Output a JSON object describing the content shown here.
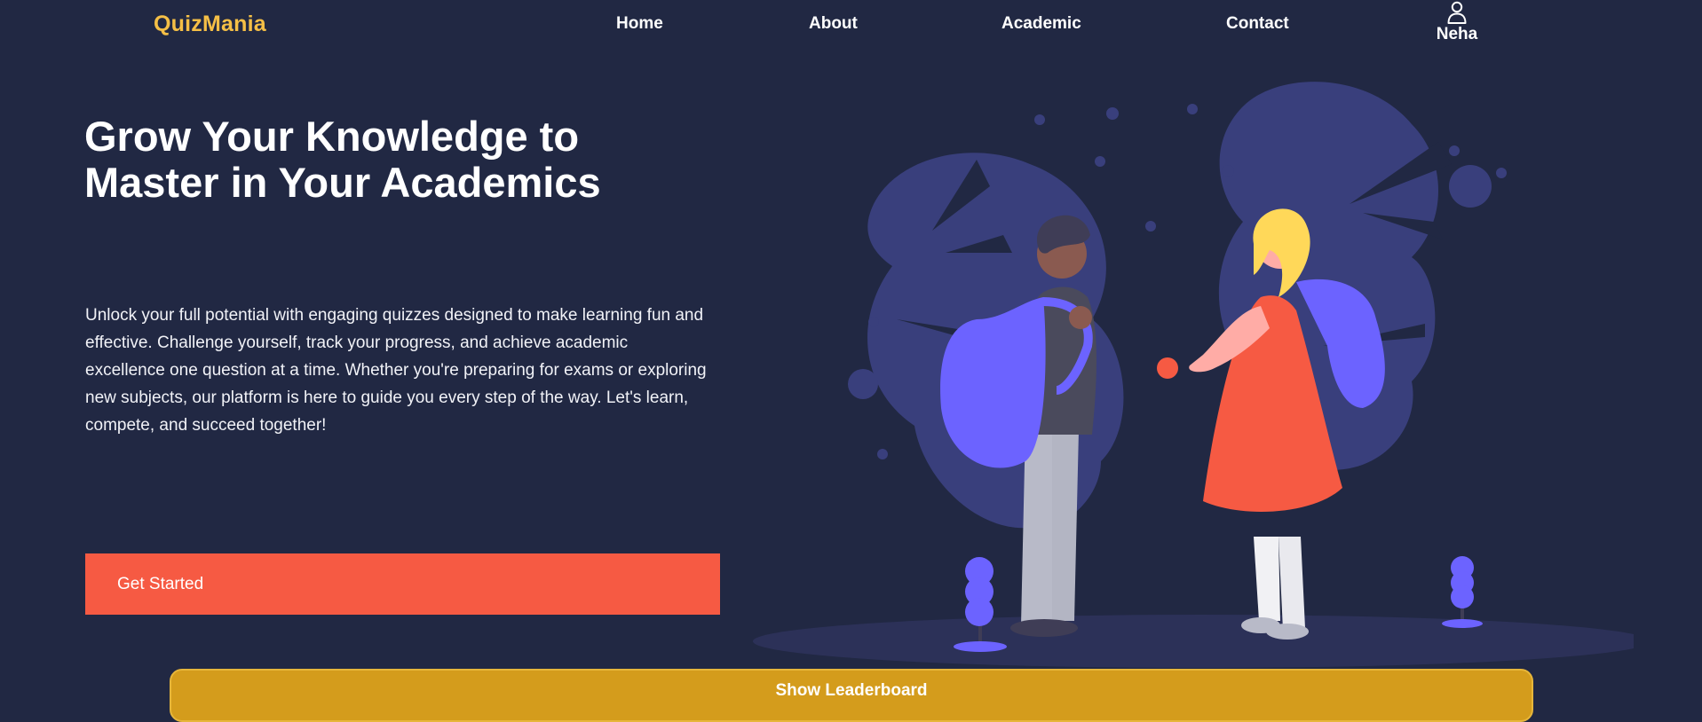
{
  "brand": "QuizMania",
  "nav": {
    "home": "Home",
    "about": "About",
    "academic": "Academic",
    "contact": "Contact"
  },
  "user": {
    "name": "Neha",
    "icon": "user-icon"
  },
  "hero": {
    "title_line1": "Grow Your Knowledge to",
    "title_line2": "Master in Your Academics",
    "description": "Unlock your full potential with engaging quizzes designed to make learning fun and effective. Challenge yourself, track your progress, and achieve academic excellence one question at a time. Whether you're preparing for exams or exploring new subjects, our platform is here to guide you every step of the way. Let's learn, compete, and succeed together!",
    "cta_label": "Get Started"
  },
  "leaderboard_label": "Show Leaderboard",
  "colors": {
    "background": "#212843",
    "brand": "#f5bf46",
    "cta": "#f65a43",
    "leaderboard": "#d49c1c",
    "illustration_accent": "#6c63ff"
  },
  "illustration": "students-with-backpacks"
}
